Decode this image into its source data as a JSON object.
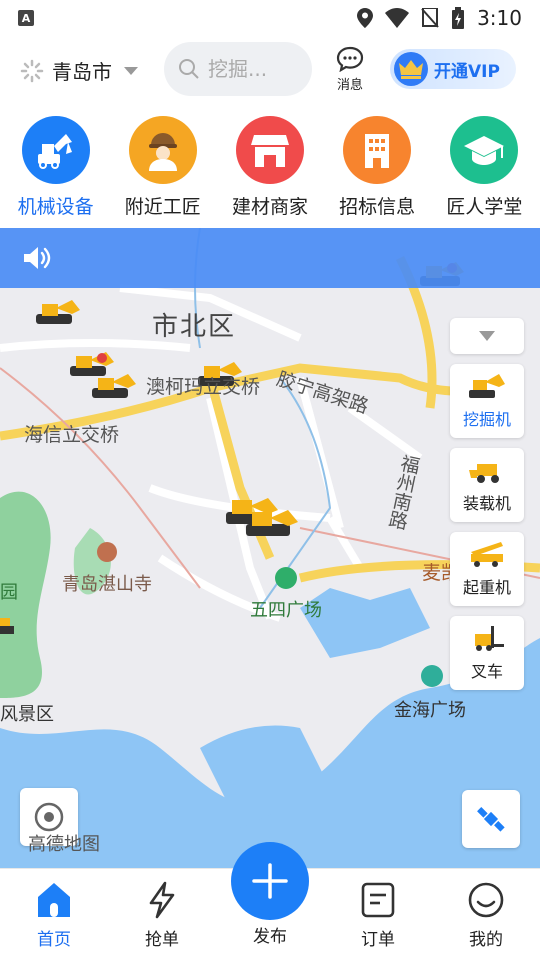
{
  "status_bar": {
    "time": "3:10",
    "left_badge": "A"
  },
  "header": {
    "city": "青岛市",
    "search_placeholder": "挖掘...",
    "message_label": "消息",
    "vip_label": "开通VIP"
  },
  "categories": [
    {
      "label": "机械设备",
      "icon": "excavator-icon",
      "color": "#1d7ff7",
      "active": true
    },
    {
      "label": "附近工匠",
      "icon": "worker-icon",
      "color": "#f5a623"
    },
    {
      "label": "建材商家",
      "icon": "shop-icon",
      "color": "#f04b4b"
    },
    {
      "label": "招标信息",
      "icon": "building-icon",
      "color": "#f7842e"
    },
    {
      "label": "匠人学堂",
      "icon": "graduation-cap-icon",
      "color": "#1dbf8f"
    }
  ],
  "map": {
    "labels": {
      "shibei": "市北区",
      "aoke": "澳柯玛立交桥",
      "haixin": "海信立交桥",
      "jiaoning": "胶宁高架路",
      "fuzhou": "福州南路",
      "zhanshan": "青岛湛山寺",
      "wusi": "五四广场",
      "jinhai": "金海广场",
      "fengjing": "风景区",
      "yuan": "园",
      "gaojia": "高架路",
      "map_brand": "高德地图",
      "mai": "麦凯",
      "nan": "南",
      "qing": "青"
    }
  },
  "machine_filter": [
    {
      "label": "挖掘机",
      "icon": "excavator-icon",
      "active": true
    },
    {
      "label": "装载机",
      "icon": "loader-icon"
    },
    {
      "label": "起重机",
      "icon": "crane-icon"
    },
    {
      "label": "叉车",
      "icon": "forklift-icon"
    }
  ],
  "tabbar": {
    "home": "首页",
    "grab": "抢单",
    "publish": "发布",
    "orders": "订单",
    "mine": "我的"
  },
  "colors": {
    "accent": "#1d7ff7",
    "notice": "#4a8cf5"
  }
}
